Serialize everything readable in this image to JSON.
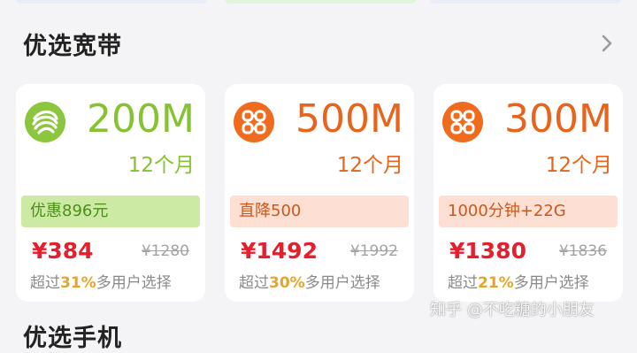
{
  "section": {
    "title": "优选宽带"
  },
  "next_section": {
    "title": "优选手机"
  },
  "cards": [
    {
      "carrier_icon": "china-mobile-logo-icon",
      "speed": "200M",
      "duration": "12个月",
      "tag": "优惠896元",
      "price": "¥384",
      "original_price": "¥1280",
      "users_prefix": "超过",
      "users_percent": "31%",
      "users_suffix": "多用户选择"
    },
    {
      "carrier_icon": "china-unicom-logo-icon",
      "speed": "500M",
      "duration": "12个月",
      "tag": "直降500",
      "price": "¥1492",
      "original_price": "¥1992",
      "users_prefix": "超过",
      "users_percent": "30%",
      "users_suffix": "多用户选择"
    },
    {
      "carrier_icon": "china-unicom-logo-icon",
      "speed": "300M",
      "duration": "12个月",
      "tag": "1000分钟+22G",
      "price": "¥1380",
      "original_price": "¥1836",
      "users_prefix": "超过",
      "users_percent": "21%",
      "users_suffix": "多用户选择"
    }
  ],
  "watermark": "知乎 @不吃糖的小朋友",
  "colors": {
    "mobile_green": "#86c232",
    "unicom_orange": "#e8641c",
    "price_red": "#e41f2e",
    "percent_gold": "#e8a428"
  }
}
